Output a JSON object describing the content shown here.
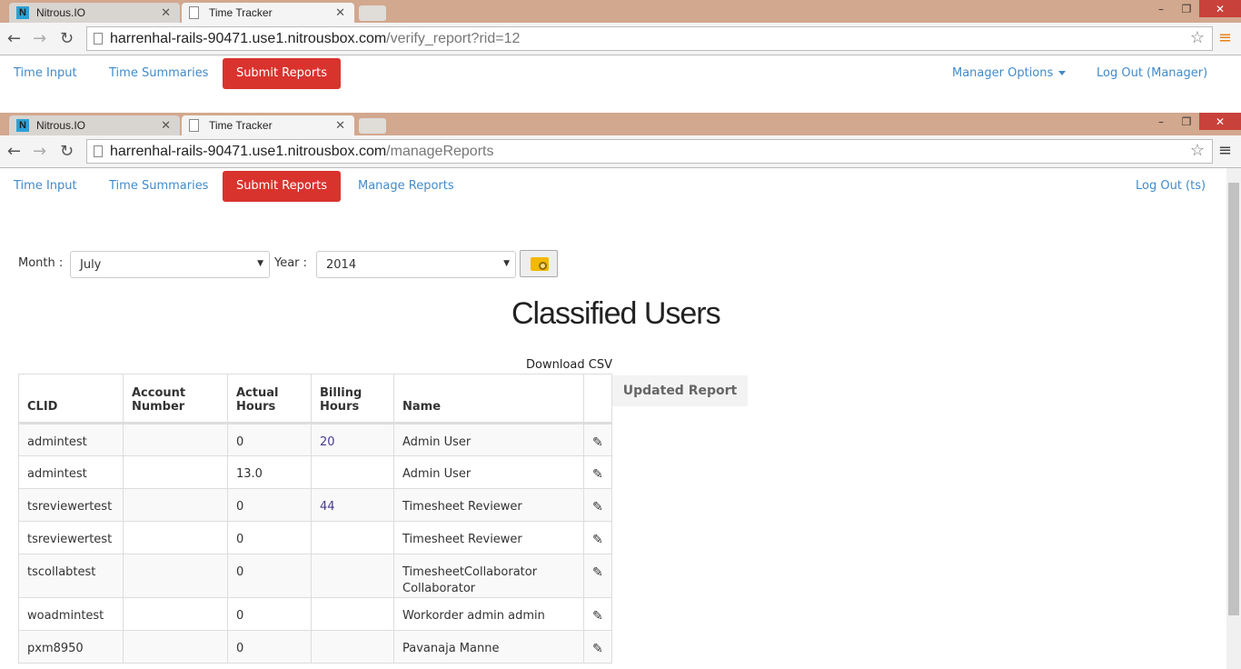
{
  "browser": {
    "tabs": [
      {
        "label": "Nitrous.IO",
        "icon": "nitrous-icon"
      },
      {
        "label": "Time Tracker",
        "icon": "page-icon"
      }
    ]
  },
  "window1": {
    "url_host": "harrenhal-rails-90471.use1.nitrousbox.com",
    "url_path": "/verify_report?rid=12",
    "nav": {
      "time_input": "Time Input",
      "time_summaries": "Time Summaries",
      "submit_reports": "Submit Reports",
      "manager_options": "Manager Options",
      "logout": "Log Out (Manager)"
    }
  },
  "window2": {
    "url_host": "harrenhal-rails-90471.use1.nitrousbox.com",
    "url_path": "/manageReports",
    "nav": {
      "time_input": "Time Input",
      "time_summaries": "Time Summaries",
      "submit_reports": "Submit Reports",
      "manage_reports": "Manage Reports",
      "logout": "Log Out (ts)"
    },
    "filters": {
      "month_label": "Month :",
      "month": "July",
      "year_label": "Year :",
      "year": "2014"
    },
    "title": "Classified Users",
    "download": "Download CSV",
    "updated_report": "Updated Report",
    "table": {
      "headers": [
        "CLID",
        "Account Number",
        "Actual Hours",
        "Billing Hours",
        "Name"
      ],
      "rows": [
        [
          "admintest",
          "",
          "0",
          "20",
          "Admin User"
        ],
        [
          "admintest",
          "",
          "13.0",
          "",
          "Admin User"
        ],
        [
          "tsreviewertest",
          "",
          "0",
          "44",
          "Timesheet Reviewer"
        ],
        [
          "tsreviewertest",
          "",
          "0",
          "",
          "Timesheet Reviewer"
        ],
        [
          "tscollabtest",
          "",
          "0",
          "",
          "TimesheetCollaborator Collaborator"
        ],
        [
          "woadmintest",
          "",
          "0",
          "",
          "Workorder admin admin"
        ],
        [
          "pxm8950",
          "",
          "0",
          "",
          "Pavanaja Manne"
        ]
      ]
    }
  },
  "colors": {
    "accent": "#d9332e",
    "link": "#428bca",
    "titlebar": "#d2a88e"
  }
}
